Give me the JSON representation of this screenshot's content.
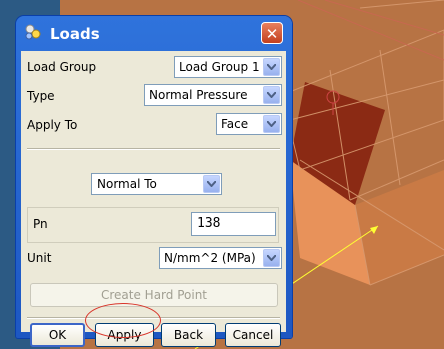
{
  "dialog": {
    "title": "Loads",
    "close_label": "✕",
    "load_group": {
      "label": "Load Group",
      "value": "Load Group 1"
    },
    "type": {
      "label": "Type",
      "value": "Normal Pressure"
    },
    "apply_to": {
      "label": "Apply To",
      "value": "Face"
    },
    "direction": {
      "value": "Normal To"
    },
    "pn": {
      "label": "Pn",
      "value": "138"
    },
    "unit": {
      "label": "Unit",
      "value": "N/mm^2 (MPa)"
    },
    "create_hard_point_label": "Create Hard Point",
    "buttons": {
      "ok": "OK",
      "apply": "Apply",
      "back": "Back",
      "cancel": "Cancel"
    }
  },
  "colors": {
    "title_bar": "#2563d0",
    "dialog_bg": "#ece9d8",
    "model_face": "#8b2a14",
    "model_side": "#e8925a",
    "canvas_bg": "#b77344",
    "highlight": "#d8342a",
    "annotation": "#ffff33"
  },
  "icons": [
    "loads-icon",
    "close-icon",
    "dropdown-arrow-icon"
  ]
}
